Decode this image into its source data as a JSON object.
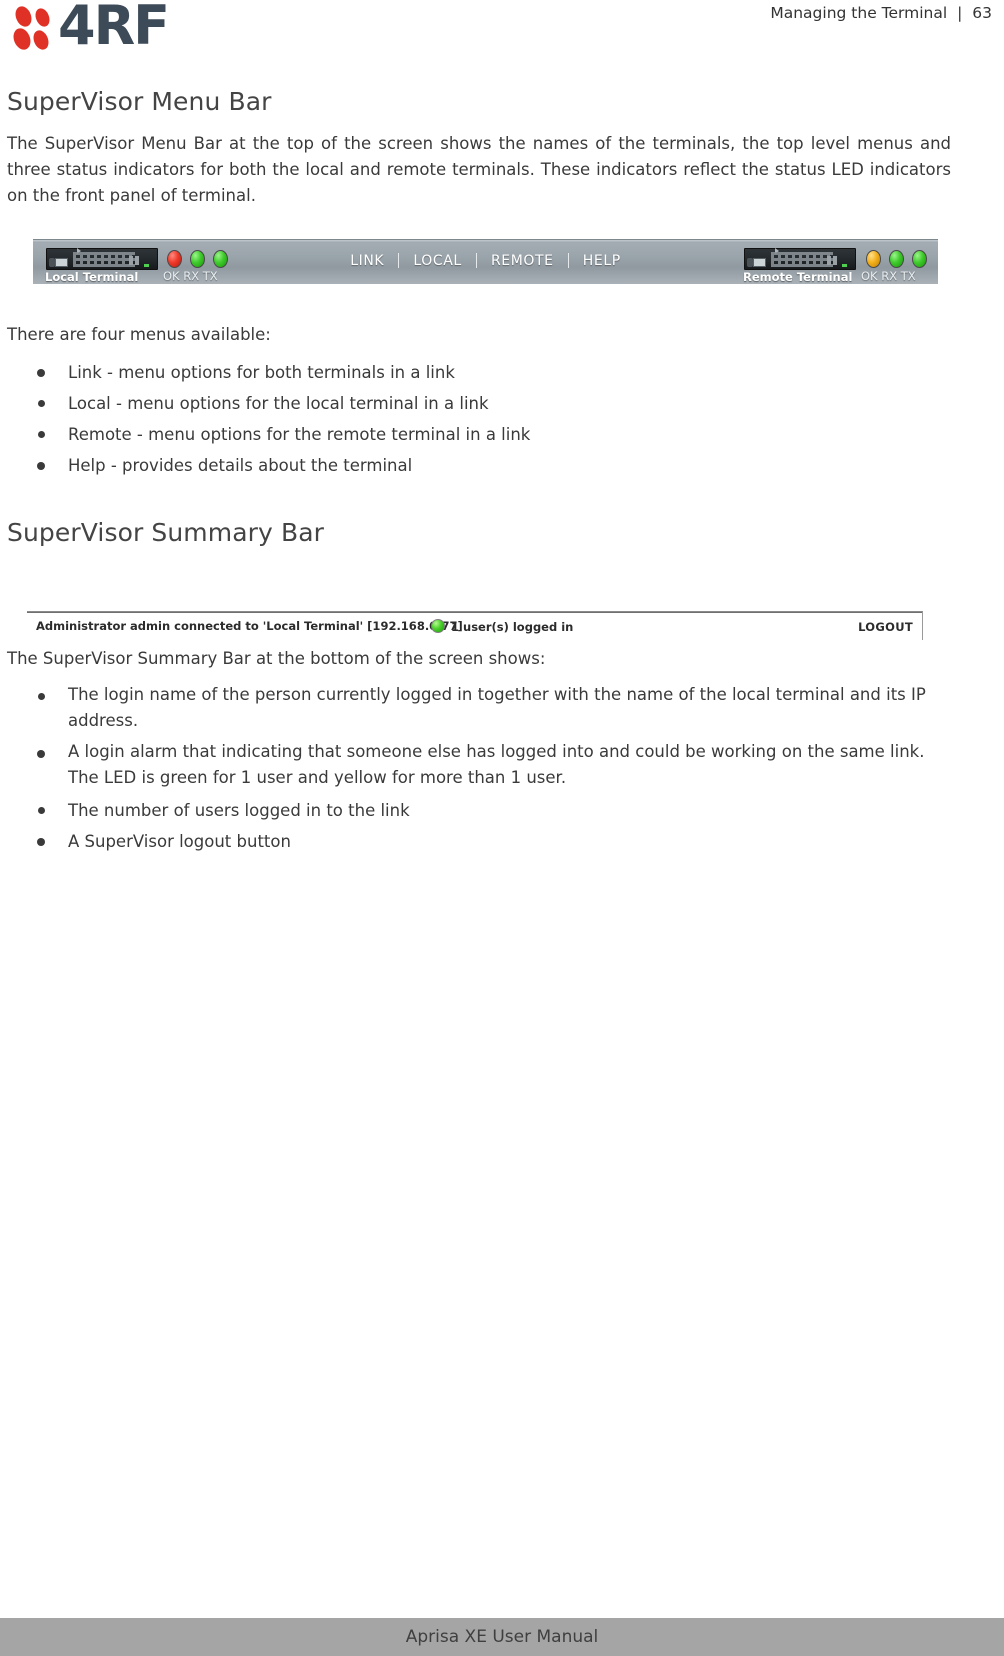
{
  "header": {
    "logo_text": "4RF",
    "logo_dot_color": "#e03127",
    "logo_word_color": "#3d4b58",
    "chapter_title": "Managing the Terminal",
    "separator": "|",
    "page_number": "63"
  },
  "sections": [
    {
      "heading": "SuperVisor Menu Bar",
      "paragraph": "The SuperVisor Menu Bar at the top of the screen shows the names of the terminals, the top level menus and three status indicators for both the local and remote terminals. These indicators reflect the status LED indicators on the front panel of terminal.",
      "intro": "There are four menus available:",
      "bullets": [
        "Link - menu options for both terminals in a link",
        "Local - menu options for the local terminal in a link",
        "Remote - menu options for the remote terminal in a link",
        "Help - provides details about the terminal"
      ]
    },
    {
      "heading": "SuperVisor Summary Bar",
      "intro": "The SuperVisor Summary Bar at the bottom of the screen shows:",
      "bullets": [
        "The login name of the person currently logged in together with the name of the local terminal and its IP address.",
        "A login alarm that indicating that someone else has logged into and could be working on the same link. The LED is green for 1 user and yellow for more than 1 user.",
        "The number of users logged in to the link",
        "A SuperVisor logout button"
      ]
    }
  ],
  "menu_bar_screenshot": {
    "local_terminal_label": "Local Terminal",
    "local_led_labels": "OK  RX  TX",
    "local_leds": [
      "red",
      "green",
      "green"
    ],
    "remote_terminal_label": "Remote Terminal",
    "remote_led_labels": "OK  RX  TX",
    "remote_leds": [
      "yellow",
      "green",
      "green"
    ],
    "menu_items": [
      "LINK",
      "LOCAL",
      "REMOTE",
      "HELP"
    ],
    "colors": {
      "red": "#ef3a2a",
      "green": "#3fcb2c",
      "yellow": "#f2b01a",
      "bar_background": "#9aa4ab"
    }
  },
  "summary_bar_screenshot": {
    "connection_text": "Administrator admin connected to 'Local Terminal' [192.168.0.77]",
    "users_text": "1 user(s) logged in",
    "users_led_color": "#4ad02b",
    "logout_label": "LOGOUT"
  },
  "footer": {
    "text": "Aprisa XE User Manual"
  }
}
